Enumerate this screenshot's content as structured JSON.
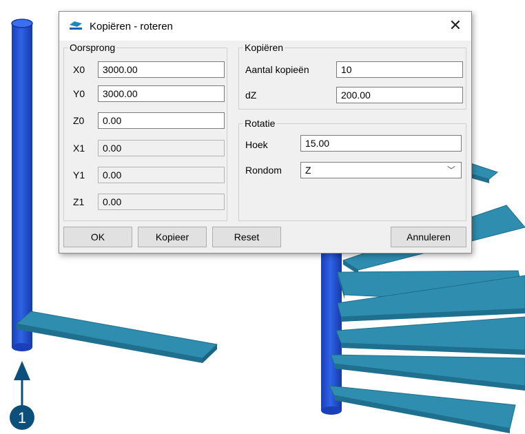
{
  "window": {
    "title": "Kopiëren - roteren",
    "close_glyph": "✕",
    "icon": "app-icon"
  },
  "oorsprong": {
    "legend": "Oorsprong",
    "fields": [
      {
        "label": "X0",
        "value": "3000.00",
        "enabled": true
      },
      {
        "label": "Y0",
        "value": "3000.00",
        "enabled": true
      },
      {
        "label": "Z0",
        "value": "0.00",
        "enabled": true
      },
      {
        "label": "X1",
        "value": "0.00",
        "enabled": false
      },
      {
        "label": "Y1",
        "value": "0.00",
        "enabled": false
      },
      {
        "label": "Z1",
        "value": "0.00",
        "enabled": false
      }
    ]
  },
  "kopieren": {
    "legend": "Kopiëren",
    "aantal_label": "Aantal kopieën",
    "aantal_value": "10",
    "dz_label": "dZ",
    "dz_value": "200.00"
  },
  "rotatie": {
    "legend": "Rotatie",
    "hoek_label": "Hoek",
    "hoek_value": "15.00",
    "rondom_label": "Rondom",
    "rondom_value": "Z",
    "chevron": "﹀"
  },
  "buttons": {
    "ok": "OK",
    "kopieer": "Kopieer",
    "reset": "Reset",
    "annuleren": "Annuleren"
  },
  "callout": {
    "number": "1"
  },
  "colors": {
    "column": "#2150d6",
    "plate": "#2b86a8",
    "callout": "#0b4f7a"
  }
}
